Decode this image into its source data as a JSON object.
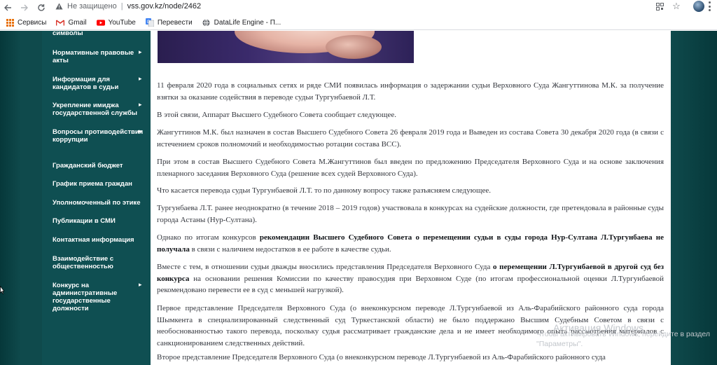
{
  "browser": {
    "security_status": "Не защищено",
    "url": "vss.gov.kz/node/2462",
    "bookmarks": [
      {
        "label": "Сервисы",
        "icon": "apps-grid-icon"
      },
      {
        "label": "Gmail",
        "icon": "gmail-icon"
      },
      {
        "label": "YouTube",
        "icon": "youtube-icon"
      },
      {
        "label": "Перевести",
        "icon": "translate-icon"
      },
      {
        "label": "DataLife Engine - П...",
        "icon": "globe-icon"
      }
    ]
  },
  "colors": {
    "background": "#0f4a4c",
    "sidebar": "#0f4f52",
    "content": "#ffffff",
    "text": "#33363d"
  },
  "sidebar": {
    "items": [
      {
        "label": "символы"
      },
      {
        "label": "Нормативные правовые акты"
      },
      {
        "label": "Информация для кандидатов в судьи"
      },
      {
        "label": "Укрепление имиджа государственной службы"
      },
      {
        "label": "Вопросы противодействия коррупции"
      },
      {
        "label": "Гражданский бюджет"
      },
      {
        "label": "График приема граждан"
      },
      {
        "label": "Уполномоченный по этике"
      },
      {
        "label": "Публикации в СМИ"
      },
      {
        "label": "Контактная информация"
      },
      {
        "label": "Взаимодействие с общественностью"
      },
      {
        "label": "Конкурс на административные государственные должности"
      }
    ]
  },
  "article": {
    "p1": "11 февраля 2020 года в социальных сетях и ряде СМИ появилась информация о задержании судьи Верховного Суда Жангуттинова М.К. за получение взятки за оказание содействия в переводе судьи Тургунбаевой Л.Т.",
    "p2": "В этой связи, Аппарат Высшего Судебного Совета сообщает следующее.",
    "p3": "Жангуттинов М.К. был назначен в состав Высшего Судебного Совета 26 февраля 2019 года и Выведен из состава Совета 30 декабря 2020 года (в связи с истечением сроков полномочий и необходимостью ротации состава ВСС).",
    "p4": "При этом в состав Высшего Судебного Совета М.Жангуттинов был введен по предложению Председателя Верховного Суда и на основе заключения пленарного заседания Верховного Суда (решение всех судей Верховного Суда).",
    "p5": "Что касается перевода судьи Тургунбаевой Л.Т. то по данному вопросу также разъясняем следующее.",
    "p6": "Тургунбаева Л.Т. ранее неоднократно (в течение 2018 – 2019 годов) участвовала в конкурсах на судейские должности, где претендовала в районные суды города Астаны (Нур-Султана).",
    "p7_a": "Однако по итогам конкурсов ",
    "p7_b": "рекомендации Высшего Судебного Совета о перемещении судьи в суды города Нур-Султана Л.Тургунбаева не получала",
    "p7_c": " в связи с наличием недостатков в ее работе в качестве судьи.",
    "p8_a": "Вместе с тем, в отношении судьи дважды вносились представления Председателя Верховного Суда ",
    "p8_b": "о перемещении Л.Тургунбаевой в другой суд без конкурса",
    "p8_c": " на основании решения Комиссии по качеству правосудия при Верховном Суде (по итогам профессиональной оценки Л.Тургунбаевой рекомендовано перевести ее в суд с меньшей нагрузкой).",
    "p9": "Первое представление Председателя Верховного Суда (о внеконкурсном переводе Л.Тургунбаевой из Аль-Фарабийского районного суда города Шымкента в специализированный следственный суд Туркестанской области) не было поддержано Высшим Судебным Советом в связи с необоснованностью такого перевода, поскольку судья рассматривает гражданские дела и не имеет необходимого опыта рассмотрения материалов с санкционированием следственных действий.",
    "p10": "Второе представление Председателя Верховного Суда (о внеконкурсном переводе Л.Тургунбаевой из Аль-Фарабийского районного суда"
  },
  "overlay": {
    "activation_title": "Активация Windows",
    "activation_text": "Чтобы активировать Windows, перейдите в раздел \"Параметры\"."
  }
}
